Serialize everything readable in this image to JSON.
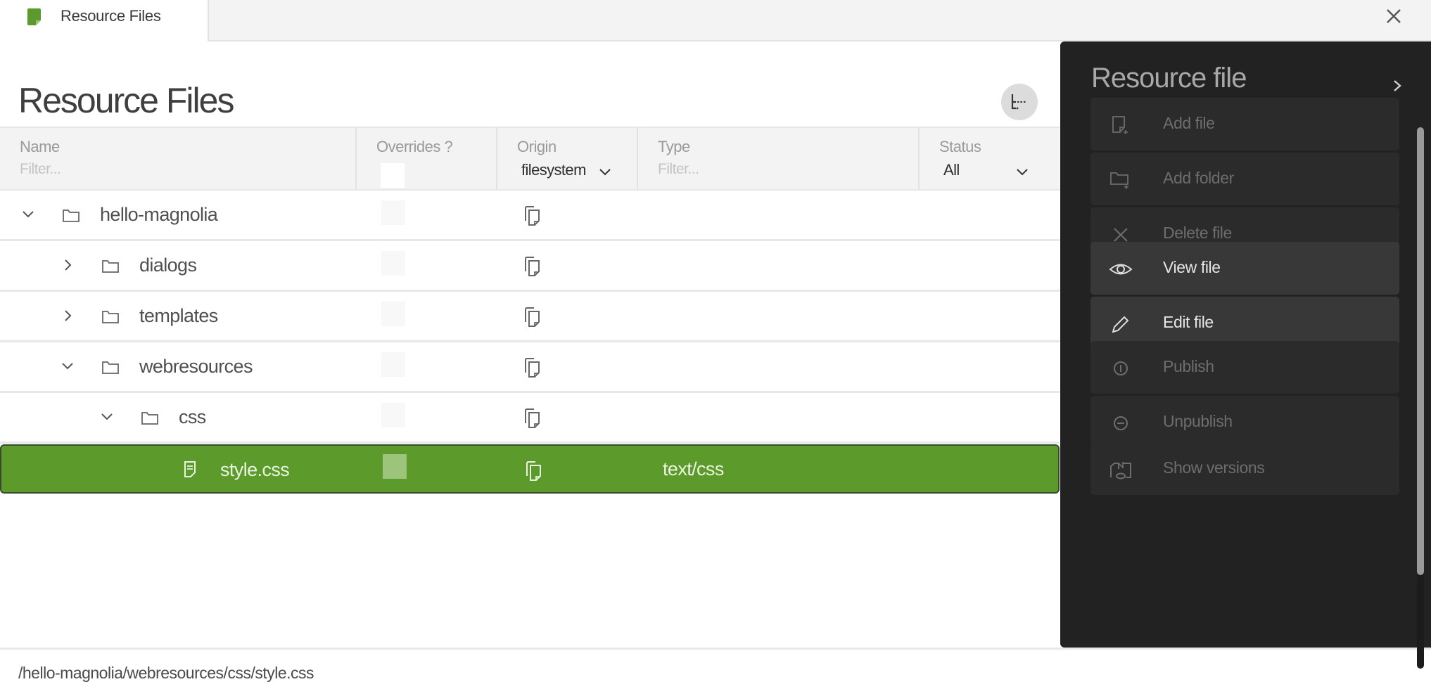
{
  "tab": {
    "label": "Resource Files",
    "icon": "resource-file-icon",
    "accent": "#5b9a2b"
  },
  "page": {
    "title": "Resource Files"
  },
  "columns": {
    "name": {
      "label": "Name",
      "filter_placeholder": "Filter..."
    },
    "overrides": {
      "label": "Overrides ?"
    },
    "origin": {
      "label": "Origin",
      "selected": "filesystem"
    },
    "type": {
      "label": "Type",
      "filter_placeholder": "Filter..."
    },
    "status": {
      "label": "Status",
      "selected": "All"
    }
  },
  "tree": [
    {
      "name": "hello-magnolia",
      "kind": "folder",
      "expanded": true,
      "depth": 0,
      "type": ""
    },
    {
      "name": "dialogs",
      "kind": "folder",
      "expanded": false,
      "depth": 1,
      "type": ""
    },
    {
      "name": "templates",
      "kind": "folder",
      "expanded": false,
      "depth": 1,
      "type": ""
    },
    {
      "name": "webresources",
      "kind": "folder",
      "expanded": true,
      "depth": 1,
      "type": ""
    },
    {
      "name": "css",
      "kind": "folder",
      "expanded": true,
      "depth": 2,
      "type": ""
    },
    {
      "name": "style.css",
      "kind": "file",
      "depth": 3,
      "type": "text/css",
      "selected": true
    }
  ],
  "status_bar": {
    "path": "/hello-magnolia/webresources/css/style.css"
  },
  "action_panel": {
    "title": "Resource file",
    "groups": [
      [
        {
          "label": "Add file",
          "icon": "add-file-icon",
          "enabled": false
        },
        {
          "label": "Add folder",
          "icon": "add-folder-icon",
          "enabled": false
        },
        {
          "label": "Delete file",
          "icon": "delete-icon",
          "enabled": false
        }
      ],
      [
        {
          "label": "View file",
          "icon": "eye-icon",
          "enabled": true
        },
        {
          "label": "Edit file",
          "icon": "pencil-icon",
          "enabled": true
        }
      ],
      [
        {
          "label": "Publish",
          "icon": "publish-icon",
          "enabled": false
        },
        {
          "label": "Unpublish",
          "icon": "unpublish-icon",
          "enabled": false
        }
      ],
      [
        {
          "label": "Show versions",
          "icon": "versions-icon",
          "enabled": false
        }
      ]
    ]
  }
}
